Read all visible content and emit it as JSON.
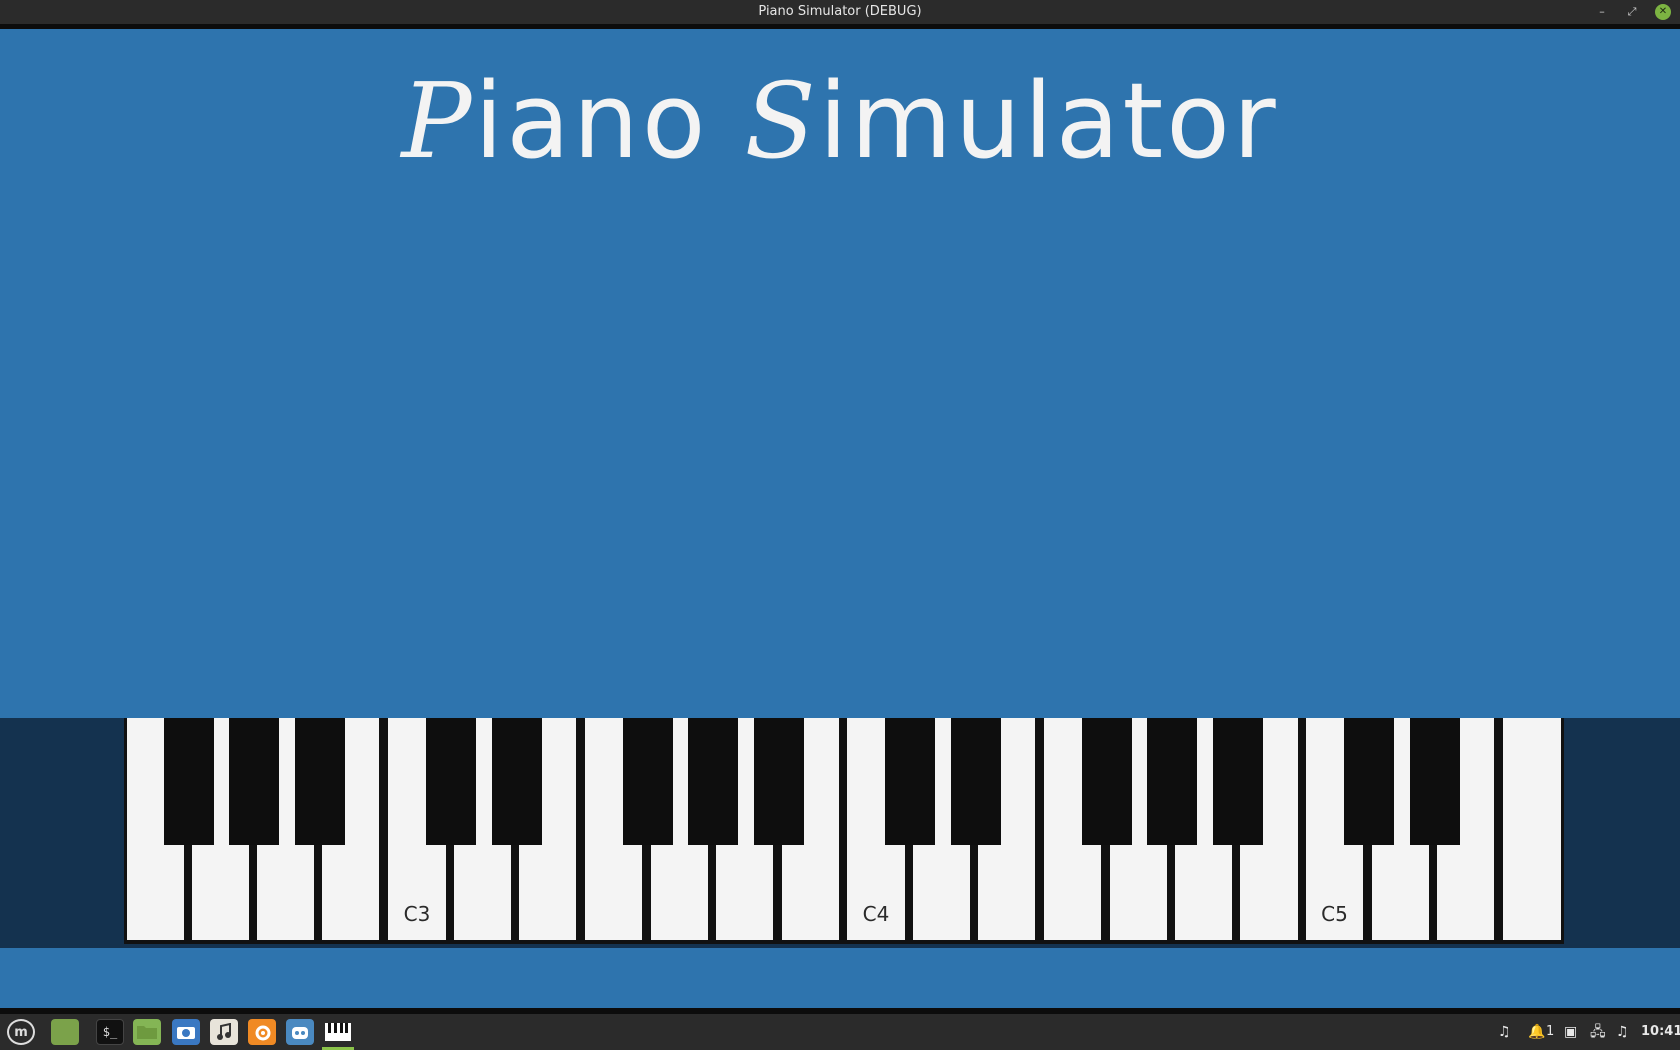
{
  "window": {
    "title": "Piano Simulator (DEBUG)",
    "min_glyph": "–",
    "max_glyph": "⤢",
    "close_glyph": "✕"
  },
  "app": {
    "title_first_cap": "P",
    "title_first_rest": "iano ",
    "title_second_cap": "S",
    "title_second_rest": "imulator",
    "background_color": "#2e74ae",
    "keybed_color": "#14324f"
  },
  "keyboard": {
    "white_key_count": 22,
    "black_key_count": 15,
    "labels": {
      "c3": "C3",
      "c4": "C4",
      "c5": "C5"
    }
  },
  "taskbar": {
    "menu_glyph": "m",
    "terminal_glyph": "$_",
    "icons": [
      "mint-menu-icon",
      "show-desktop-icon",
      "terminal-icon",
      "files-icon",
      "screenshot-icon",
      "music-player-icon",
      "blender-icon",
      "godot-icon",
      "piano-app-icon"
    ],
    "tray": {
      "music1": "♫",
      "notif": "🔔",
      "notif_count": "1",
      "screen": "▣",
      "network": "🖧",
      "music2": "♫",
      "clock": "10:41"
    }
  }
}
